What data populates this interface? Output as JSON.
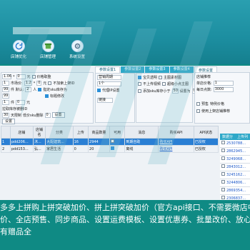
{
  "toolbar": [
    {
      "label": "店铺优化",
      "icon": "refresh-icon"
    },
    {
      "label": "店铺管理",
      "icon": "store-icon"
    },
    {
      "label": "系统设置",
      "icon": "gear-icon"
    }
  ],
  "tabs": [
    "参数设置1",
    "参数设置2",
    "参数设置3",
    "参数设置4"
  ],
  "right_tab": "参数设置",
  "left_params": {
    "row1": {
      "a": "1.06",
      "op": "*",
      "b": "0",
      "unit": "元",
      "chk": "价格取整"
    },
    "row2": {
      "a": "1",
      "label": "市场价:",
      "b": "1.2",
      "op": "*",
      "c": "0",
      "unit": "元",
      "chk": "不加索上架ID"
    },
    "row3": {
      "a": "99",
      "label": "件 默认:",
      "b": "2",
      "unit": "人",
      "chk": "指定sku库存为"
    },
    "row4": {
      "a": "99",
      "chk": "标题修改"
    },
    "row5": {
      "a": "1",
      "label": "件 ",
      "b": "0",
      "unit": "元"
    },
    "row6": {
      "label": "拉取库存被删ID"
    },
    "row7": {
      "a": "30",
      "label": "天限制",
      "b": "低价sku删除",
      "c": "0",
      "btn": "设置"
    },
    "row8": {
      "label": "设置"
    }
  },
  "mid_params": {
    "selects": [
      "营销周期",
      "1个"
    ],
    "proxy_chk": "代理IP设置",
    "link": "链接"
  },
  "right_params": {
    "c1": "宝贝透明",
    "c2": "主图素材图",
    "c3": "不上传视频",
    "c4": "超级小点主图",
    "stock_label": "添加sku库存小于",
    "stock_val": "50",
    "stock_unit": "设置为",
    "stock_val2": "0"
  },
  "far_right": {
    "title": "店铺推荐",
    "price_label": "单店价格:",
    "price_val": "1",
    "label2": "每日点数:",
    "val2": "3000",
    "chk1": "预售",
    "label3": "特例价格",
    "chk2": "使用上架店铺推荐"
  },
  "table": {
    "headers": [
      "",
      "店铺",
      "店铺名",
      "分类",
      "上传",
      "商品数量",
      "可用",
      "消息",
      "购买API",
      "API状态"
    ],
    "rows": [
      {
        "idx": "1",
        "shop": "pdd206...",
        "name": "沐...",
        "cat": "大配建筑...",
        "up": "16",
        "qty": "2944",
        "ok": "",
        "msg": "到期自助",
        "api": "购买API",
        "status": "已授权"
      },
      {
        "idx": "2",
        "shop": "pdd153...",
        "name": "弘...",
        "cat": "家居生活",
        "up": "0",
        "qty": "20",
        "ok": "",
        "msg": "离线",
        "api": "购买API",
        "status": "已授权"
      }
    ]
  },
  "right_list": {
    "tabs": [
      "数据分类",
      "上传列表"
    ],
    "items": [
      "2530788...",
      "2862945...",
      "3249068...",
      "2843012...",
      "3245162...",
      "3244806...",
      "2869354...",
      "2306837..."
    ]
  },
  "caption": [
    "多多上拼购上拼突破加价、拼上拼突破加价（官方api接口、不需要微店中转、",
    "价、全店预售、同步商品、设置运费模板、设置优惠券、批量改价、放心推",
    "有赠品全"
  ]
}
